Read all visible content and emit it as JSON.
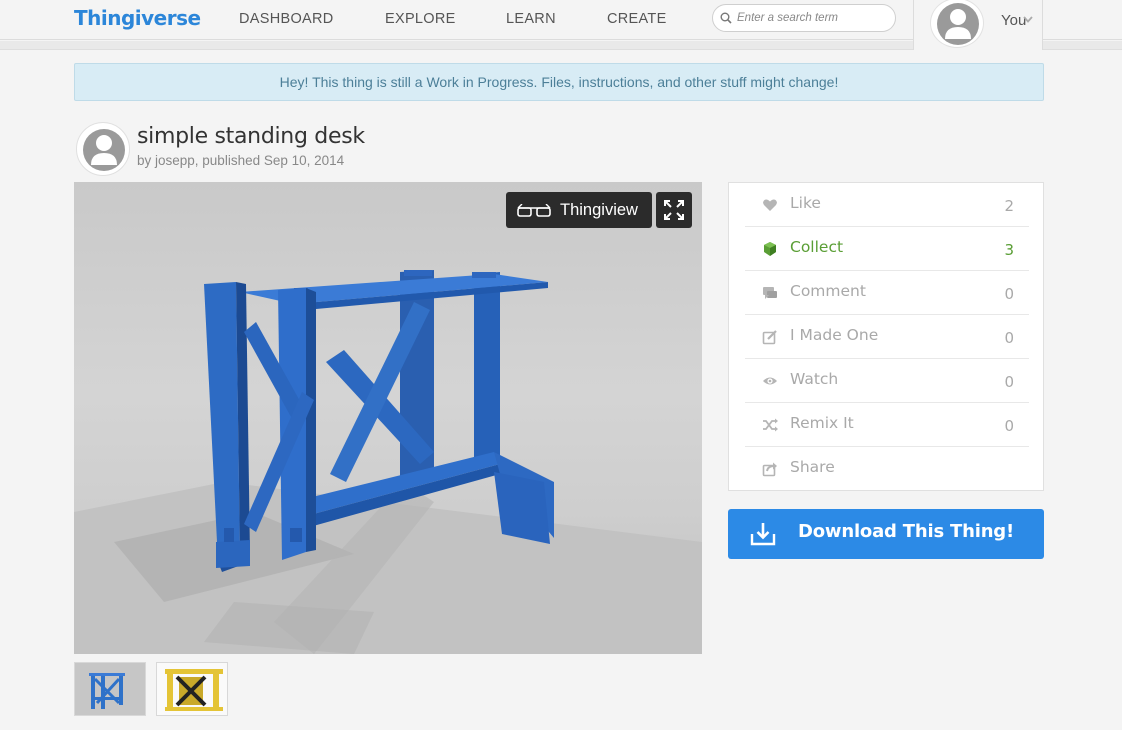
{
  "header": {
    "logo": "Thingiverse",
    "nav": [
      "DASHBOARD",
      "EXPLORE",
      "LEARN",
      "CREATE"
    ],
    "search_placeholder": "Enter a search term",
    "user_label": "You"
  },
  "banner": {
    "text": "Hey! This thing is still a Work in Progress. Files, instructions, and other stuff might change!"
  },
  "thing": {
    "title": "simple standing desk",
    "byline": "by josepp, published Sep 10, 2014"
  },
  "viewer": {
    "thingiview_label": "Thingiview"
  },
  "actions": [
    {
      "label": "Like",
      "count": "2",
      "icon": "heart-icon"
    },
    {
      "label": "Collect",
      "count": "3",
      "icon": "collect-cube-icon"
    },
    {
      "label": "Comment",
      "count": "0",
      "icon": "comment-icon"
    },
    {
      "label": "I Made One",
      "count": "0",
      "icon": "made-one-icon"
    },
    {
      "label": "Watch",
      "count": "0",
      "icon": "eye-icon"
    },
    {
      "label": "Remix It",
      "count": "0",
      "icon": "shuffle-icon"
    },
    {
      "label": "Share",
      "count": "",
      "icon": "share-icon"
    }
  ],
  "download": {
    "label": "Download This Thing!"
  },
  "colors": {
    "brand_blue": "#2c86d9",
    "download_blue": "#2c8ae6",
    "collect_green": "#5a9e35",
    "model_blue": "#2f72c9",
    "model_yellow": "#e4c436"
  }
}
